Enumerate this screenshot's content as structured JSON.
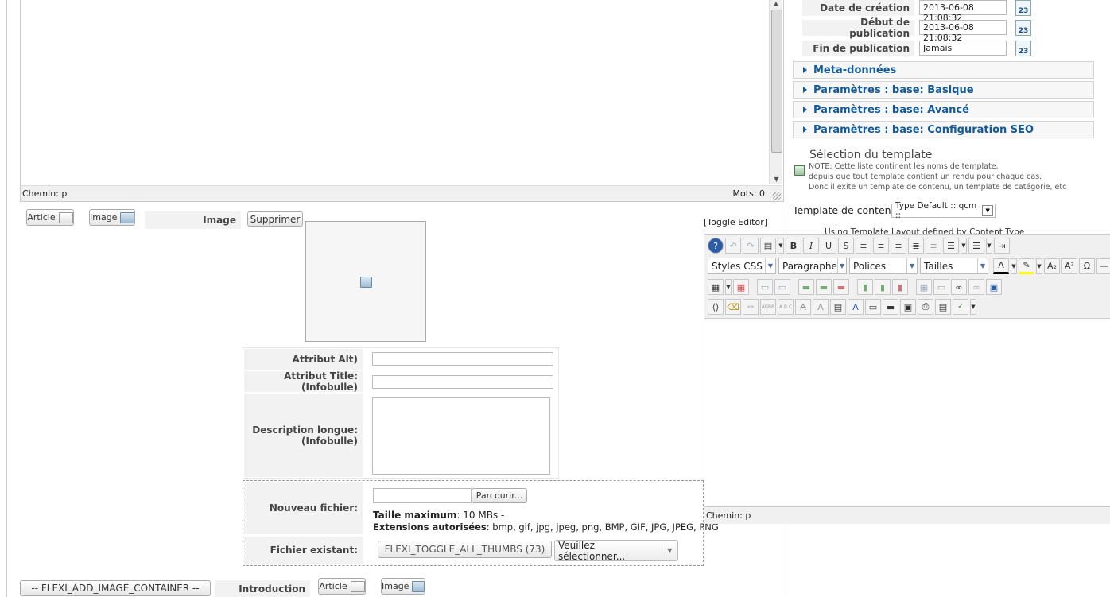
{
  "top_editor": {
    "path_label": "Chemin: p",
    "word_count": "Mots: 0"
  },
  "dates": [
    {
      "label": "Date de création",
      "value": "2013-06-08 21:08:32",
      "cal": "23"
    },
    {
      "label": "Début de publication",
      "value": "2013-06-08 21:08:32",
      "cal": "23"
    },
    {
      "label": "Fin de publication",
      "value": "Jamais",
      "cal": "23"
    }
  ],
  "accordions": [
    "Meta-données",
    "Paramètres : base: Basique",
    "Paramètres : base: Avancé",
    "Paramètres : base: Configuration SEO"
  ],
  "template": {
    "title": "Sélection du template",
    "note1": "NOTE: Cette liste continent les noms de template,",
    "note2": "depuis que tout template contient un rendu pour chaque cas.",
    "note3": "Donc il exite un template de contenu, un template de catégorie, etc",
    "content_label": "Template de contenu",
    "content_value": "Type Default :: qcm ::",
    "using_text": "Using Template Layout defined by Content Type"
  },
  "image_field": {
    "article_btn": "Article",
    "image_btn": "Image",
    "label": "Image",
    "delete_btn": "Supprimer",
    "alt_label": "Attribut Alt)",
    "title_label": "Attribut Title: (Infobulle)",
    "desc_label_1": "Description longue:",
    "desc_label_2": "(Infobulle)",
    "new_file_label": "Nouveau fichier:",
    "browse_btn": "Parcourir...",
    "max_size_label": "Taille maximum",
    "max_size_value": ": 10 MBs  -",
    "ext_label": "Extensions autorisées",
    "ext_value": ": bmp, gif, jpg, jpeg, png, BMP, GIF, JPG, JPEG, PNG",
    "existing_label": "Fichier existant:",
    "toggle_thumbs": "FLEXI_TOGGLE_ALL_THUMBS (73)",
    "select_placeholder": "Veuillez sélectionner..."
  },
  "right_editor": {
    "toggle": "[Toggle Editor]",
    "styles": "Styles CSS",
    "format": "Paragraphe",
    "fonts": "Polices",
    "sizes": "Tailles",
    "path_label": "Chemin: p"
  },
  "bottom": {
    "add_container": "-- FLEXI_ADD_IMAGE_CONTAINER --",
    "intro_label": "Introduction",
    "article_btn": "Article",
    "image_btn": "Image"
  }
}
